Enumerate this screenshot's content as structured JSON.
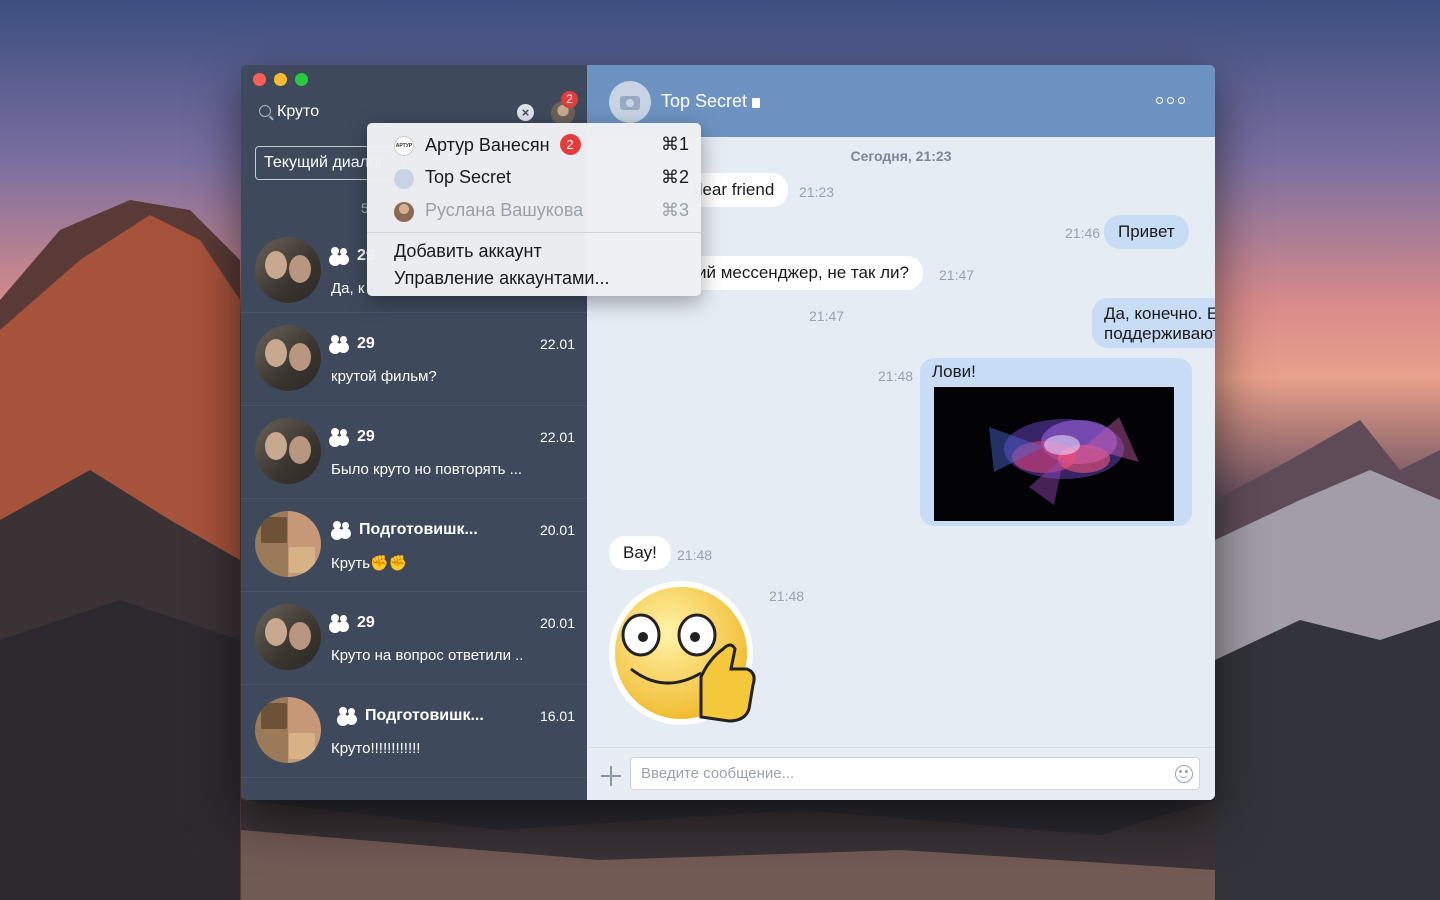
{
  "search": {
    "value": "Круто"
  },
  "account_badge": "2",
  "filter_button": "Текущий диалог",
  "sidebar_count": "5",
  "dialogs": [
    {
      "name": "29",
      "date": "",
      "preview": "Да, к"
    },
    {
      "name": "29",
      "date": "22.01",
      "preview": "крутой фильм?"
    },
    {
      "name": "29",
      "date": "22.01",
      "preview": "Было круто но повторять ..."
    },
    {
      "name": "Подготовишк...",
      "date": "20.01",
      "preview": "Круть✊✊"
    },
    {
      "name": "29",
      "date": "20.01",
      "preview": "Круто на вопрос ответили .."
    },
    {
      "name": "Подготовишк...",
      "date": "16.01",
      "preview": "Круто!!!!!!!!!!!!"
    }
  ],
  "menu": {
    "accounts": [
      {
        "label": "Артур Ванесян",
        "badge": "2",
        "shortcut": "⌘1",
        "avatar_text": "АРТУР"
      },
      {
        "label": "Top Secret",
        "shortcut": "⌘2"
      },
      {
        "label": "Руслана Вашукова",
        "shortcut": "⌘3"
      }
    ],
    "add_account": "Добавить аккаунт",
    "manage_accounts": "Управление аккаунтами..."
  },
  "chat": {
    "title": "Top Secret",
    "day_separator": "Сегодня, 21:23",
    "messages": [
      {
        "text": "dear friend",
        "time": "21:23",
        "dir": "in"
      },
      {
        "text": "Привет",
        "time": "21:46",
        "dir": "out"
      },
      {
        "text": "ий мессенджер, не так ли?",
        "time": "21:47",
        "dir": "in"
      },
      {
        "line1": "Да, конечно. Еще и мультиаккаунт",
        "line2": "поддерживаются - вообще космос!",
        "time": "21:47",
        "dir": "out"
      },
      {
        "text": "Лови!",
        "time": "21:48",
        "dir": "out"
      },
      {
        "text": "Вау!",
        "time": "21:48",
        "dir": "in"
      },
      {
        "time": "21:48",
        "dir": "in",
        "sticker": true
      }
    ],
    "composer_placeholder": "Введите сообщение..."
  },
  "colors": {
    "sidebar": "#3e4a5c",
    "header": "#6d93c2",
    "chat_bg": "#e6ecf4",
    "out_bubble": "#c9dcf5",
    "badge": "#e53b3b"
  }
}
